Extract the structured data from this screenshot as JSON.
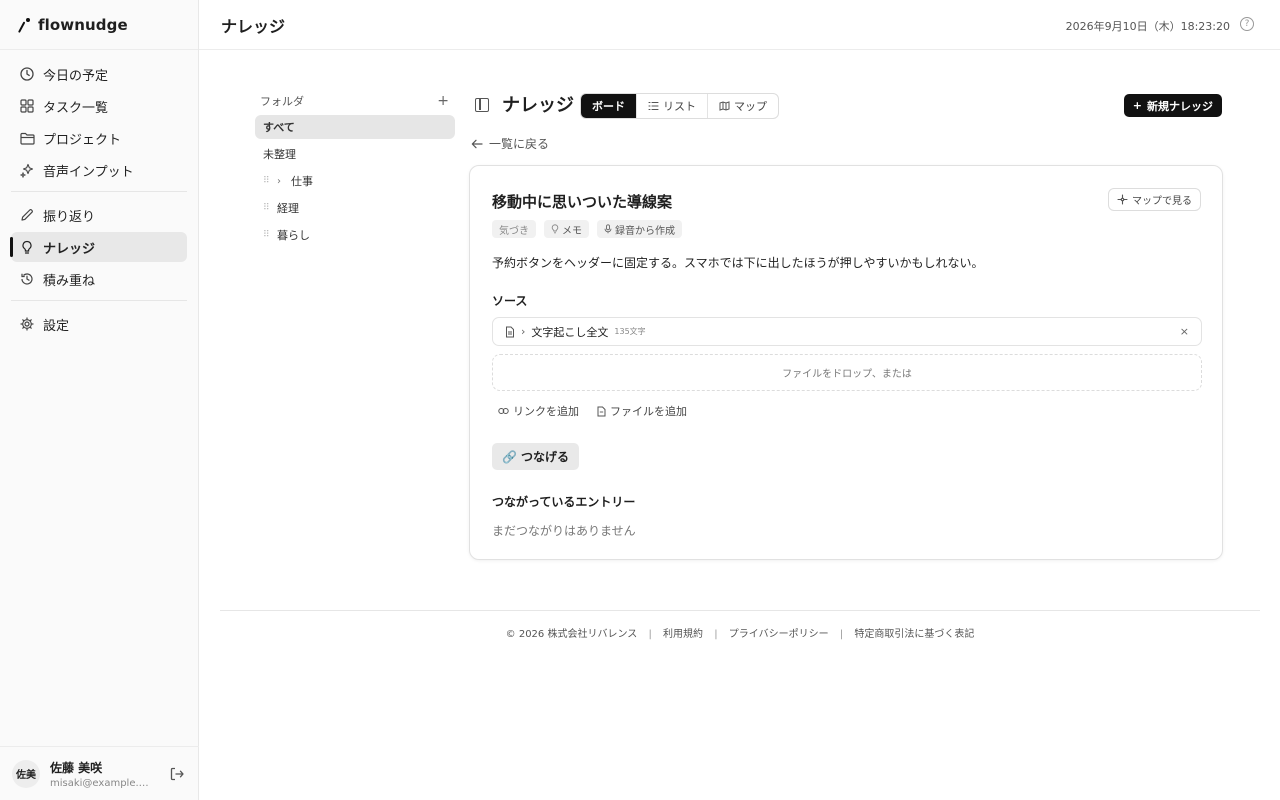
{
  "app": {
    "name": "flownudge"
  },
  "header": {
    "title": "ナレッジ",
    "datetime": "2026年9月10日（木）18:23:20"
  },
  "sidebar": {
    "items": [
      {
        "label": "今日の予定",
        "icon": "clock-icon"
      },
      {
        "label": "タスク一覧",
        "icon": "grid-icon"
      },
      {
        "label": "プロジェクト",
        "icon": "folder-icon"
      },
      {
        "label": "音声インプット",
        "icon": "sparkle-icon"
      },
      {
        "label": "振り返り",
        "icon": "pencil-icon"
      },
      {
        "label": "ナレッジ",
        "icon": "lightbulb-icon",
        "active": true
      },
      {
        "label": "積み重ね",
        "icon": "history-icon"
      },
      {
        "label": "設定",
        "icon": "gear-icon"
      }
    ]
  },
  "user": {
    "avatar": "佐美",
    "name": "佐藤 美咲",
    "email": "misaki@example.com"
  },
  "folders": {
    "title": "フォルダ",
    "items": [
      {
        "label": "すべて"
      },
      {
        "label": "未整理"
      },
      {
        "label": "仕事"
      },
      {
        "label": "経理"
      },
      {
        "label": "暮らし"
      }
    ]
  },
  "main": {
    "title": "ナレッジ",
    "views": [
      "ボード",
      "リスト",
      "マップ"
    ],
    "active_view": "ボード",
    "new_button": "新規ナレッジ",
    "back": "一覧に戻る"
  },
  "entry": {
    "title": "移動中に思いついた導線案",
    "map_button": "マップで見る",
    "tags": [
      "気づき",
      "メモ",
      "録音から作成"
    ],
    "body": "予約ボタンをヘッダーに固定する。スマホでは下に出したほうが押しやすいかもしれない。",
    "source_label": "ソース",
    "source_item": {
      "name": "文字起こし全文",
      "count": "135文字"
    },
    "drop_text": "ファイルをドロップ、または",
    "add_link": "リンクを追加",
    "add_file": "ファイルを追加",
    "connect_button": "つなげる",
    "connected_title": "つながっているエントリー",
    "connected_empty": "まだつながりはありません"
  },
  "footer": {
    "copyright": "© 2026 株式会社リバレンス",
    "terms": "利用規約",
    "privacy": "プライバシーポリシー",
    "legal": "特定商取引法に基づく表記"
  }
}
